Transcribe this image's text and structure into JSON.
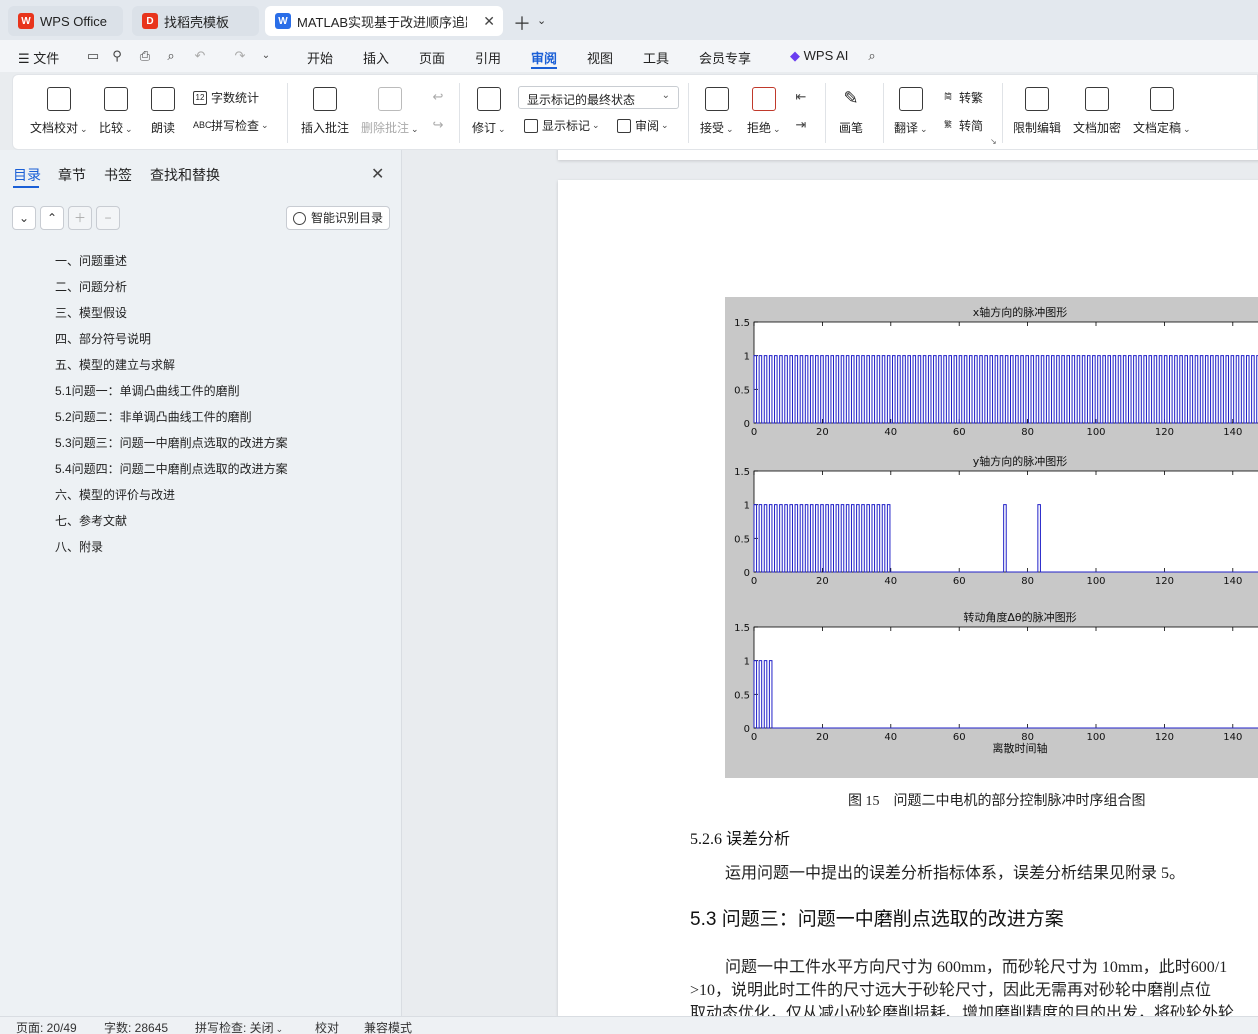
{
  "tabs": [
    {
      "label": "WPS Office",
      "icon": "wps-logo-icon"
    },
    {
      "label": "找稻壳模板",
      "icon": "docer-logo-icon"
    },
    {
      "label": "MATLAB实现基于改进顺序追踪",
      "icon": "word-doc-icon"
    }
  ],
  "menubar": {
    "file": "文件",
    "items": [
      "开始",
      "插入",
      "页面",
      "引用",
      "审阅",
      "视图",
      "工具",
      "会员专享"
    ],
    "active": "审阅",
    "wps_ai": "WPS AI"
  },
  "ribbon": {
    "doc_check": "文档校对",
    "compare": "比较",
    "read_aloud": "朗读",
    "word_count": "字数统计",
    "spell_check": "拼写检查",
    "insert_comment": "插入批注",
    "delete_comment": "删除批注",
    "revise": "修订",
    "markup_state": "显示标记的最终状态",
    "show_markup": "显示标记",
    "review": "审阅",
    "accept": "接受",
    "reject": "拒绝",
    "pen": "画笔",
    "translate": "翻译",
    "to_traditional": "转繁",
    "to_simplified": "转简",
    "restrict_edit": "限制编辑",
    "encrypt": "文档加密",
    "finalize": "文档定稿"
  },
  "sidebar": {
    "tabs": [
      "目录",
      "章节",
      "书签",
      "查找和替换"
    ],
    "active_tab": "目录",
    "smart_toc": "智能识别目录",
    "toc": [
      "一、问题重述",
      "二、问题分析",
      "三、模型假设",
      "四、部分符号说明",
      "五、模型的建立与求解",
      "5.1问题一：单调凸曲线工件的磨削",
      "5.2问题二：非单调凸曲线工件的磨削",
      "5.3问题三：问题一中磨削点选取的改进方案",
      "5.4问题四：问题二中磨削点选取的改进方案",
      "六、模型的评价与改进",
      "七、参考文献",
      "八、附录"
    ]
  },
  "document": {
    "caption": "图 15　问题二中电机的部分控制脉冲时序组合图",
    "section_526": "5.2.6 误差分析",
    "para_526": "运用问题一中提出的误差分析指标体系，误差分析结果见附录 5。",
    "section_53": "5.3  问题三：问题一中磨削点选取的改进方案",
    "para_53_l1": "问题一中工件水平方向尺寸为 600mm，而砂轮尺寸为 10mm，此时600/1",
    "para_53_l2": ">10，说明此时工件的尺寸远大于砂轮尺寸，因此无需再对砂轮中磨削点位",
    "para_53_l3": "取动态优化，仅从减小砂轮磨削损耗、增加磨削精度的目的出发，将砂轮外轮"
  },
  "status": {
    "page": "页面: 20/49",
    "words": "字数: 28645",
    "spell": "拼写检查: 关闭",
    "proof": "校对",
    "compat": "兼容模式"
  },
  "chart_data": [
    {
      "type": "line",
      "title": "x轴方向的脉冲图形",
      "xlim": [
        0,
        150
      ],
      "ylim": [
        0,
        1.5
      ],
      "xticks": [
        0,
        20,
        40,
        60,
        80,
        100,
        120,
        140
      ],
      "yticks": [
        0,
        0.5,
        1,
        1.5
      ],
      "xlabel": "",
      "pulse_start": 0,
      "pulse_end": 150,
      "pulse_period": 1.5,
      "pulse_high": 1
    },
    {
      "type": "line",
      "title": "y轴方向的脉冲图形",
      "xlim": [
        0,
        150
      ],
      "ylim": [
        0,
        1.5
      ],
      "xticks": [
        0,
        20,
        40,
        60,
        80,
        100,
        120,
        140
      ],
      "yticks": [
        0,
        0.5,
        1,
        1.5
      ],
      "xlabel": "",
      "pulse_start": 0,
      "pulse_end": 40,
      "pulse_period": 1.5,
      "pulse_high": 1,
      "extra_pulses": [
        73,
        83
      ]
    },
    {
      "type": "line",
      "title": "转动角度Δθ的脉冲图形",
      "xlim": [
        0,
        150
      ],
      "ylim": [
        0,
        1.5
      ],
      "xticks": [
        0,
        20,
        40,
        60,
        80,
        100,
        120,
        140
      ],
      "yticks": [
        0,
        0.5,
        1,
        1.5
      ],
      "xlabel": "离散时间轴",
      "pulse_start": 0,
      "pulse_end": 6,
      "pulse_period": 1.5,
      "pulse_high": 1
    }
  ]
}
